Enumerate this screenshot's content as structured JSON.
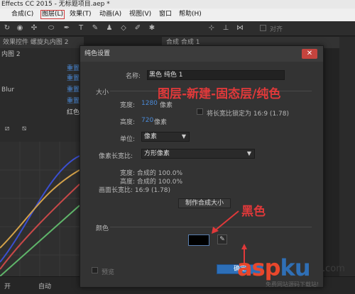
{
  "window": {
    "title": "Effects CC 2015 - 无标题项目.aep *"
  },
  "menu": [
    "合成(C)",
    "图层(L)",
    "效果(T)",
    "动画(A)",
    "视图(V)",
    "窗口",
    "帮助(H)"
  ],
  "toolbar": {
    "snap_label": "对齐"
  },
  "left_panel": {
    "tab": "效果控件 螺旋丸内图 2",
    "sub_tab": "内图 2",
    "rows": [
      {
        "label": "",
        "link": "重置"
      },
      {
        "label": "",
        "link": "重置"
      },
      {
        "label": "Blur",
        "link": "重置"
      },
      {
        "label": "",
        "link": "重置"
      },
      {
        "label": "",
        "value": "红色"
      }
    ]
  },
  "comp_strip": {
    "label": "合成 合成 1"
  },
  "bottom": {
    "auto_label": "自动",
    "left_label": "开"
  },
  "dialog": {
    "title": "纯色设置",
    "close": "✕",
    "name_label": "名称:",
    "name_value": "黑色 纯色 1",
    "size_label": "大小",
    "width_label": "宽度:",
    "width_value": "1280",
    "width_unit": "像素",
    "height_label": "高度:",
    "height_value": "720",
    "height_unit": "像素",
    "lock_label": "将长宽比锁定为 16:9 (1.78)",
    "units_label": "单位:",
    "units_value": "像素",
    "par_label": "像素长宽比:",
    "par_value": "方形像素",
    "info_width": "宽度: 合成的 100.0%",
    "info_height": "高度: 合成的 100.0%",
    "info_frame": "画面长宽比: 16:9 (1.78)",
    "make_comp_size": "制作合成大小",
    "color_label": "颜色",
    "color_value": "#000000",
    "preview_label": "预览",
    "ok_label": "确定"
  },
  "annotations": {
    "path_note": "图层-新建-固态层/纯色",
    "color_note": "黑色"
  },
  "watermark": {
    "brand_a": "asp",
    "brand_b": "ku",
    "tld": ".com",
    "sub": "免费网站源码下载站!"
  },
  "colors": {
    "annotation": "#e0393a",
    "link": "#4a8ad8",
    "ok": "#2d6fb8"
  }
}
